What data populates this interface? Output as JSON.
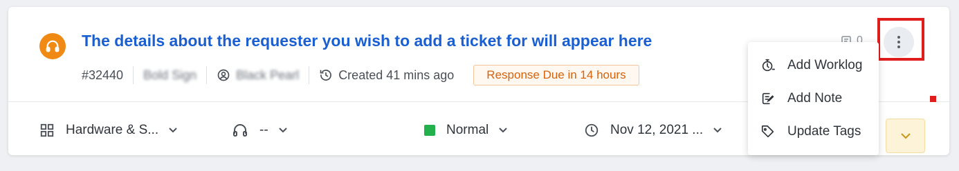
{
  "ticket": {
    "title": "The details about the requester you wish to add a ticket for will appear here",
    "id": "#32440",
    "account": "Bold Sign",
    "requester": "Black Pearl",
    "created": "Created 41 mins ago",
    "response_badge": "Response Due in 14 hours",
    "conversation_count": "0"
  },
  "fields": {
    "category": "Hardware & S...",
    "agent": "--",
    "priority": "Normal",
    "due_date": "Nov 12, 2021 ..."
  },
  "menu": {
    "items": [
      {
        "label": "Add Worklog",
        "icon": "worklog-icon"
      },
      {
        "label": "Add Note",
        "icon": "note-icon"
      },
      {
        "label": "Update Tags",
        "icon": "tag-icon"
      }
    ]
  },
  "colors": {
    "title": "#1a5fd1",
    "avatar": "#f08a14",
    "badge_text": "#d8620b",
    "priority_normal": "#22b14c",
    "highlight": "#e01d1d"
  }
}
